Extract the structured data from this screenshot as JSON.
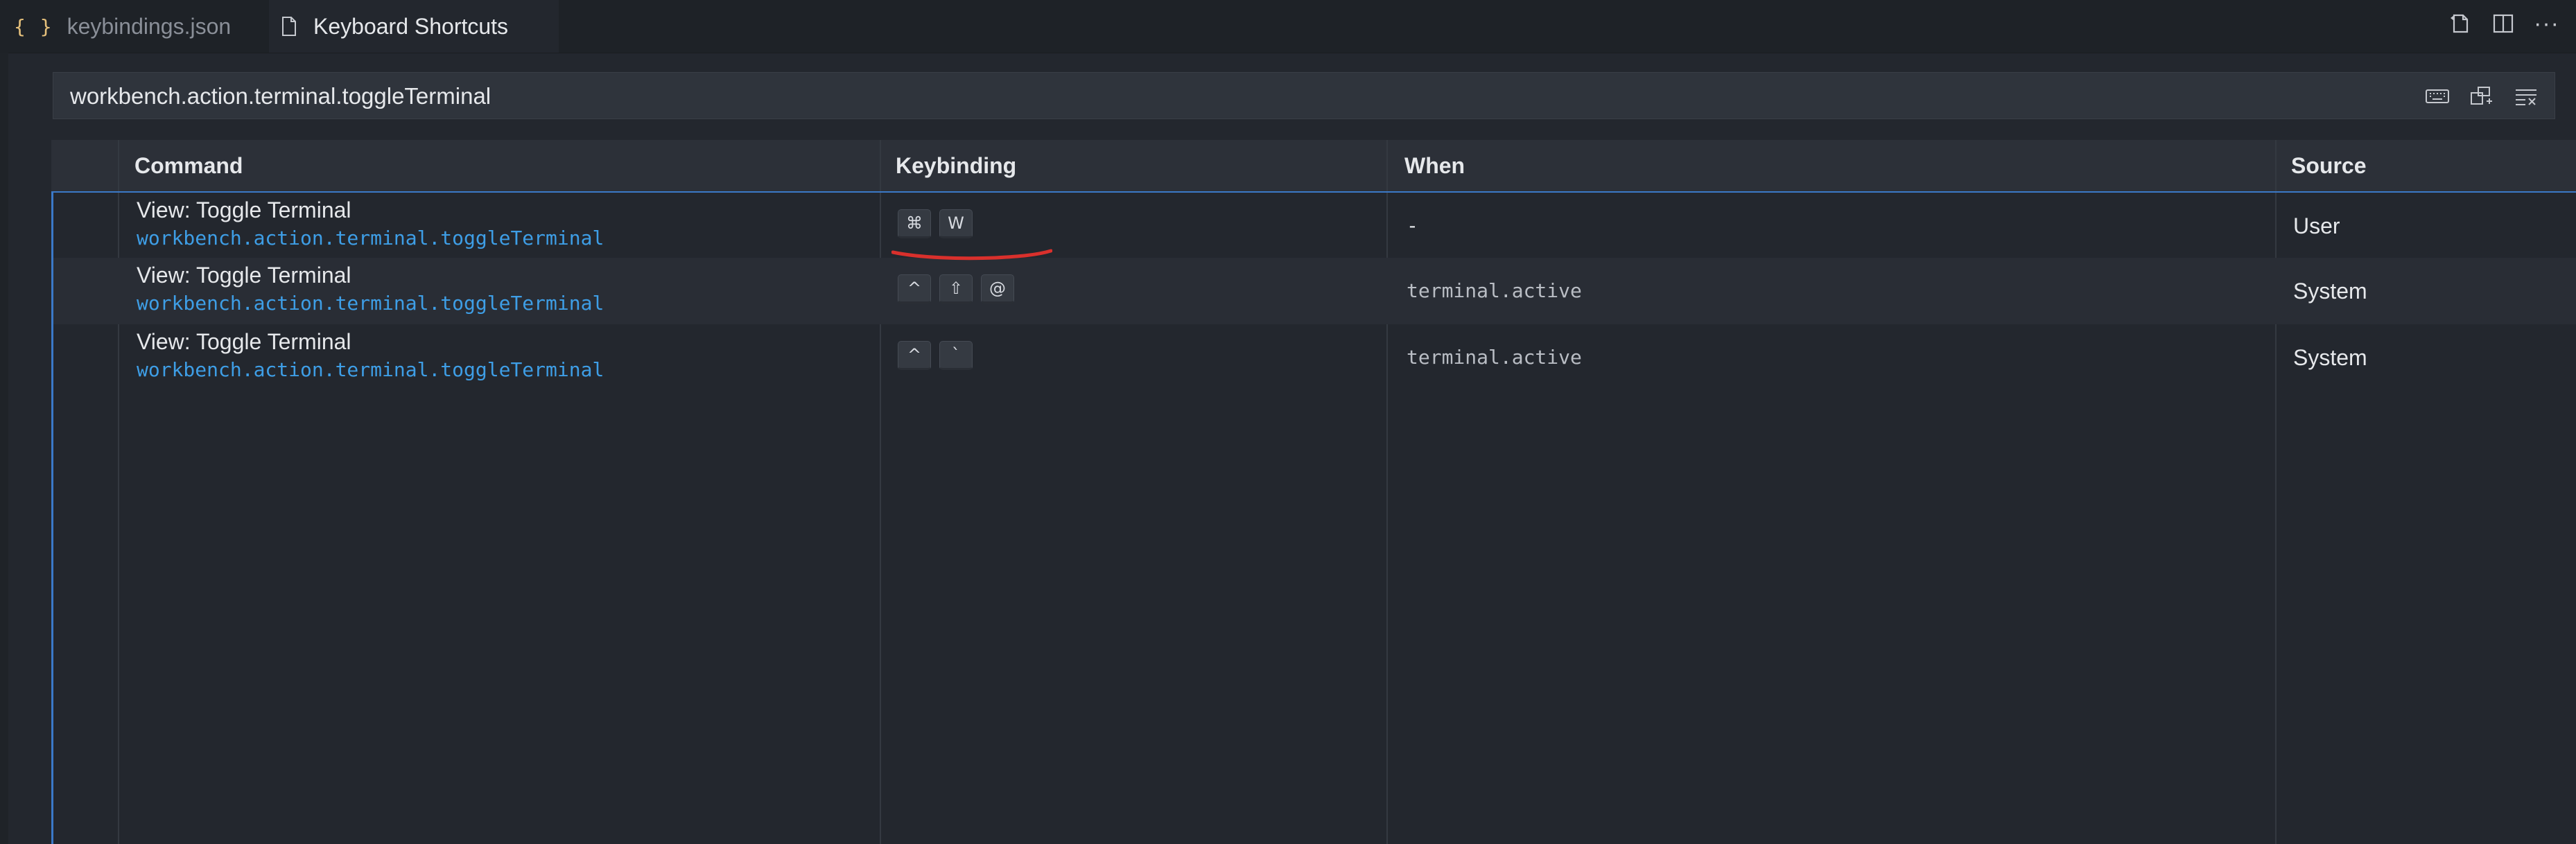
{
  "tabs": [
    {
      "label": "keybindings.json",
      "icon": "json-braces-icon",
      "icon_glyph": "{ }",
      "active": false
    },
    {
      "label": "Keyboard Shortcuts",
      "icon": "file-icon",
      "active": true
    }
  ],
  "top_actions": [
    "open-keybindings-json-icon",
    "split-editor-icon",
    "more-actions-icon"
  ],
  "top_actions_more_glyph": "···",
  "search": {
    "value": "workbench.action.terminal.toggleTerminal"
  },
  "search_actions": [
    "record-keys-icon",
    "sort-by-precedence-icon",
    "clear-search-icon"
  ],
  "columns": {
    "command": "Command",
    "keybinding": "Keybinding",
    "when": "When",
    "source": "Source"
  },
  "rows": [
    {
      "title": "View: Toggle Terminal",
      "id": "workbench.action.terminal.toggleTerminal",
      "keys": [
        "⌘",
        "W"
      ],
      "when": "-",
      "source": "User"
    },
    {
      "title": "View: Toggle Terminal",
      "id": "workbench.action.terminal.toggleTerminal",
      "keys": [
        "^",
        "⇧",
        "@"
      ],
      "when": "terminal.active",
      "source": "System"
    },
    {
      "title": "View: Toggle Terminal",
      "id": "workbench.action.terminal.toggleTerminal",
      "keys": [
        "^",
        "`"
      ],
      "when": "terminal.active",
      "source": "System"
    }
  ],
  "colors": {
    "accent": "#3b79c8",
    "command_id": "#3e9ee6",
    "annotation": "#d9302c",
    "json_icon": "#e5c07b"
  }
}
